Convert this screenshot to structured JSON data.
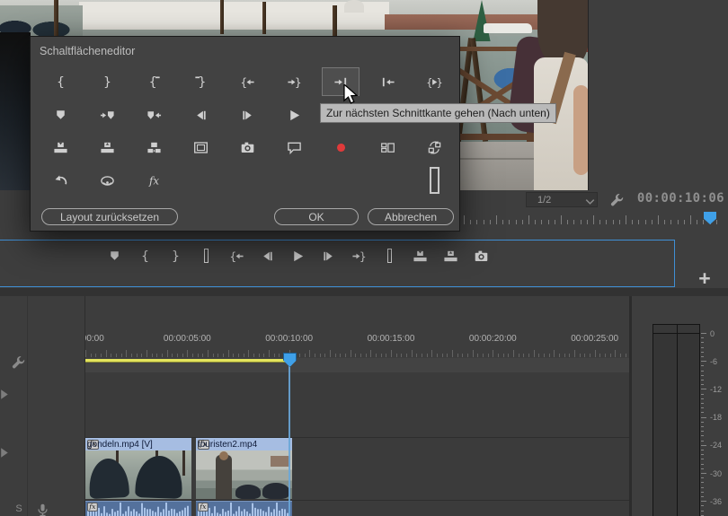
{
  "dialog": {
    "title": "Schaltflächeneditor",
    "rows": [
      {
        "icons": [
          {
            "icon": "mark-in",
            "col": 0
          },
          {
            "icon": "mark-out",
            "col": 1
          },
          {
            "icon": "clear-in",
            "col": 2
          },
          {
            "icon": "clear-out",
            "col": 3
          },
          {
            "icon": "go-to-in",
            "col": 4
          },
          {
            "icon": "go-to-out",
            "col": 5
          },
          {
            "icon": "next-edit-point",
            "col": 6
          },
          {
            "icon": "prev-edit-point",
            "col": 7
          },
          {
            "icon": "play-in-to-out",
            "col": 8
          }
        ]
      },
      {
        "icons": [
          {
            "icon": "add-marker",
            "col": 0
          },
          {
            "icon": "go-to-next-marker",
            "col": 1
          },
          {
            "icon": "go-to-prev-marker",
            "col": 2
          },
          {
            "icon": "step-back",
            "col": 3
          },
          {
            "icon": "step-forward",
            "col": 4
          },
          {
            "icon": "play",
            "col": 5
          }
        ]
      },
      {
        "icons": [
          {
            "icon": "lift",
            "col": 0
          },
          {
            "icon": "extract",
            "col": 1
          },
          {
            "icon": "insert",
            "col": 2
          },
          {
            "icon": "safe-margins",
            "col": 3
          },
          {
            "icon": "export-frame",
            "col": 4
          },
          {
            "icon": "captions",
            "col": 5
          },
          {
            "icon": "record",
            "col": 6
          },
          {
            "icon": "multicam-view",
            "col": 7
          },
          {
            "icon": "loop",
            "col": 8
          }
        ]
      },
      {
        "icons": [
          {
            "icon": "undo",
            "col": 0
          },
          {
            "icon": "proxies",
            "col": 1
          },
          {
            "icon": "global-fx-mute",
            "col": 2
          },
          {
            "icon": "spacer",
            "col": 8
          }
        ]
      }
    ],
    "highlighted_icon": "next-edit-point",
    "tooltip": {
      "icon": "next-edit-point",
      "text": "Zur nächsten Schnittkante gehen (Nach unten)"
    },
    "footer": {
      "reset": "Layout zurücksetzen",
      "ok": "OK",
      "cancel": "Abbrechen"
    }
  },
  "program_monitor": {
    "playback_resolution": "1/2",
    "timecode": "00:00:10:06"
  },
  "transport_bar": {
    "icons": [
      "add-marker",
      "mark-in",
      "mark-out",
      "separator",
      "go-to-in",
      "step-back",
      "play",
      "step-forward",
      "go-to-out",
      "separator",
      "lift",
      "extract",
      "export-frame"
    ],
    "add_label": "+"
  },
  "timeline": {
    "ruler_labels": [
      ":00:00",
      "00:00:05:00",
      "00:00:10:00",
      "00:00:15:00",
      "00:00:20:00",
      "00:00:25:00"
    ],
    "seconds_per_label": 5,
    "clips": [
      {
        "label": "gondeln.mp4 [V]",
        "fx_badge": "fx"
      },
      {
        "label": "touristen2.mp4",
        "fx_badge": "fx"
      }
    ],
    "solo_label": "S"
  },
  "audio_meter": {
    "labels": [
      "0",
      "-6",
      "-12",
      "-18",
      "-24",
      "-30",
      "-36"
    ]
  },
  "colors": {
    "accent_blue": "#3f8fd5",
    "playhead_blue": "#3fa0e8",
    "render_bar_yellow": "#e3e45c",
    "record_red": "#e03a3a",
    "clip_header_blue": "#a6bde2",
    "audio_clip_blue": "#54719c"
  }
}
